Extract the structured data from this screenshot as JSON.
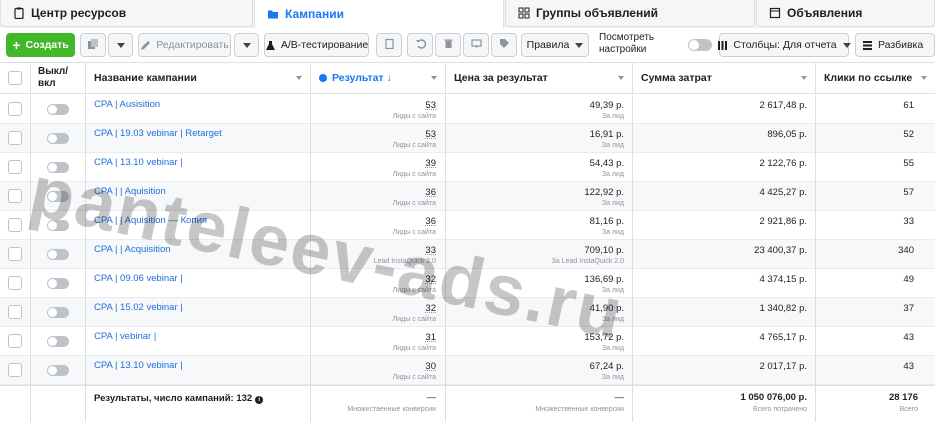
{
  "tabs": [
    {
      "label": "Центр ресурсов",
      "icon": "clipboard-icon"
    },
    {
      "label": "Кампании",
      "icon": "folder-icon",
      "active": true
    },
    {
      "label": "Группы объявлений",
      "icon": "grid-icon"
    },
    {
      "label": "Объявления",
      "icon": "page-icon"
    }
  ],
  "toolbar": {
    "create_label": "Создать",
    "edit_label": "Редактировать",
    "ab_label": "A/B-тестирование",
    "rules_label": "Правила",
    "view_settings_line1": "Посмотреть",
    "view_settings_line2": "настройки",
    "columns_label": "Столбцы: Для отчета",
    "breakdown_label": "Разбивка"
  },
  "table": {
    "headers": {
      "toggle": "Выкл/\nвкл",
      "toggle_line1": "Выкл/",
      "toggle_line2": "вкл",
      "name": "Название кампании",
      "result": "Результат ↓",
      "cost": "Цена за результат",
      "spend": "Сумма затрат",
      "clicks": "Клики по ссылке"
    },
    "rows": [
      {
        "name": "CPA |           Ausisition",
        "result": "53",
        "result_sub": "Лиды с сайта",
        "cost": "49,39 р.",
        "cost_sub": "За лид",
        "spend": "2 617,48 р.",
        "clicks": "61"
      },
      {
        "name": "CPA | 19.03 vebinar | Retarget",
        "result": "53",
        "result_sub": "Лиды с сайта",
        "cost": "16,91 р.",
        "cost_sub": "За лид",
        "spend": "896,05 р.",
        "clicks": "52"
      },
      {
        "name": "CPA | 13.10 vebinar |",
        "result": "39",
        "result_sub": "Лиды с сайта",
        "cost": "54,43 р.",
        "cost_sub": "За лид",
        "spend": "2 122,76 р.",
        "clicks": "55"
      },
      {
        "name": "CPA |        | Aquisition",
        "result": "36",
        "result_sub": "Лиды с сайта",
        "cost": "122,92 р.",
        "cost_sub": "За лид",
        "spend": "4 425,27 р.",
        "clicks": "57"
      },
      {
        "name": "CPA |              | Aquisition — Копия",
        "result": "36",
        "result_sub": "Лиды с сайта",
        "cost": "81,16 р.",
        "cost_sub": "За лид",
        "spend": "2 921,86 р.",
        "clicks": "33"
      },
      {
        "name": "CPA |        | Acquisition",
        "result": "33",
        "result_sub": "Lead InstaQuick 2.0",
        "cost": "709,10 р.",
        "cost_sub": "За Lead InstaQuick 2.0",
        "spend": "23 400,37 р.",
        "clicks": "340"
      },
      {
        "name": "CPA | 09.06 vebinar |",
        "result": "32",
        "result_sub": "Лиды с сайта",
        "cost": "136,69 р.",
        "cost_sub": "За лид",
        "spend": "4 374,15 р.",
        "clicks": "49"
      },
      {
        "name": "CPA | 15.02 vebinar |",
        "result": "32",
        "result_sub": "Лиды с сайта",
        "cost": "41,90 р.",
        "cost_sub": "За лид",
        "spend": "1 340,82 р.",
        "clicks": "37"
      },
      {
        "name": "CPA | vebinar |",
        "result": "31",
        "result_sub": "Лиды с сайта",
        "cost": "153,72 р.",
        "cost_sub": "За лид",
        "spend": "4 765,17 р.",
        "clicks": "43"
      },
      {
        "name": "CPA | 13.10 vebinar |",
        "result": "30",
        "result_sub": "Лиды с сайта",
        "cost": "67,24 р.",
        "cost_sub": "За лид",
        "spend": "2 017,17 р.",
        "clicks": "43"
      }
    ],
    "footer": {
      "label": "Результаты, число кампаний: 132",
      "result": "—",
      "result_sub": "Множественные конверсии",
      "cost": "—",
      "cost_sub": "Множественные конверсии",
      "spend": "1 050 076,00 р.",
      "spend_sub": "Всего потрачено",
      "clicks": "28 176",
      "clicks_sub": "Всего"
    }
  },
  "watermark": "panteleev-ads.ru",
  "colors": {
    "accent": "#1877f2",
    "create": "#42b72a",
    "link": "#216fdb"
  }
}
